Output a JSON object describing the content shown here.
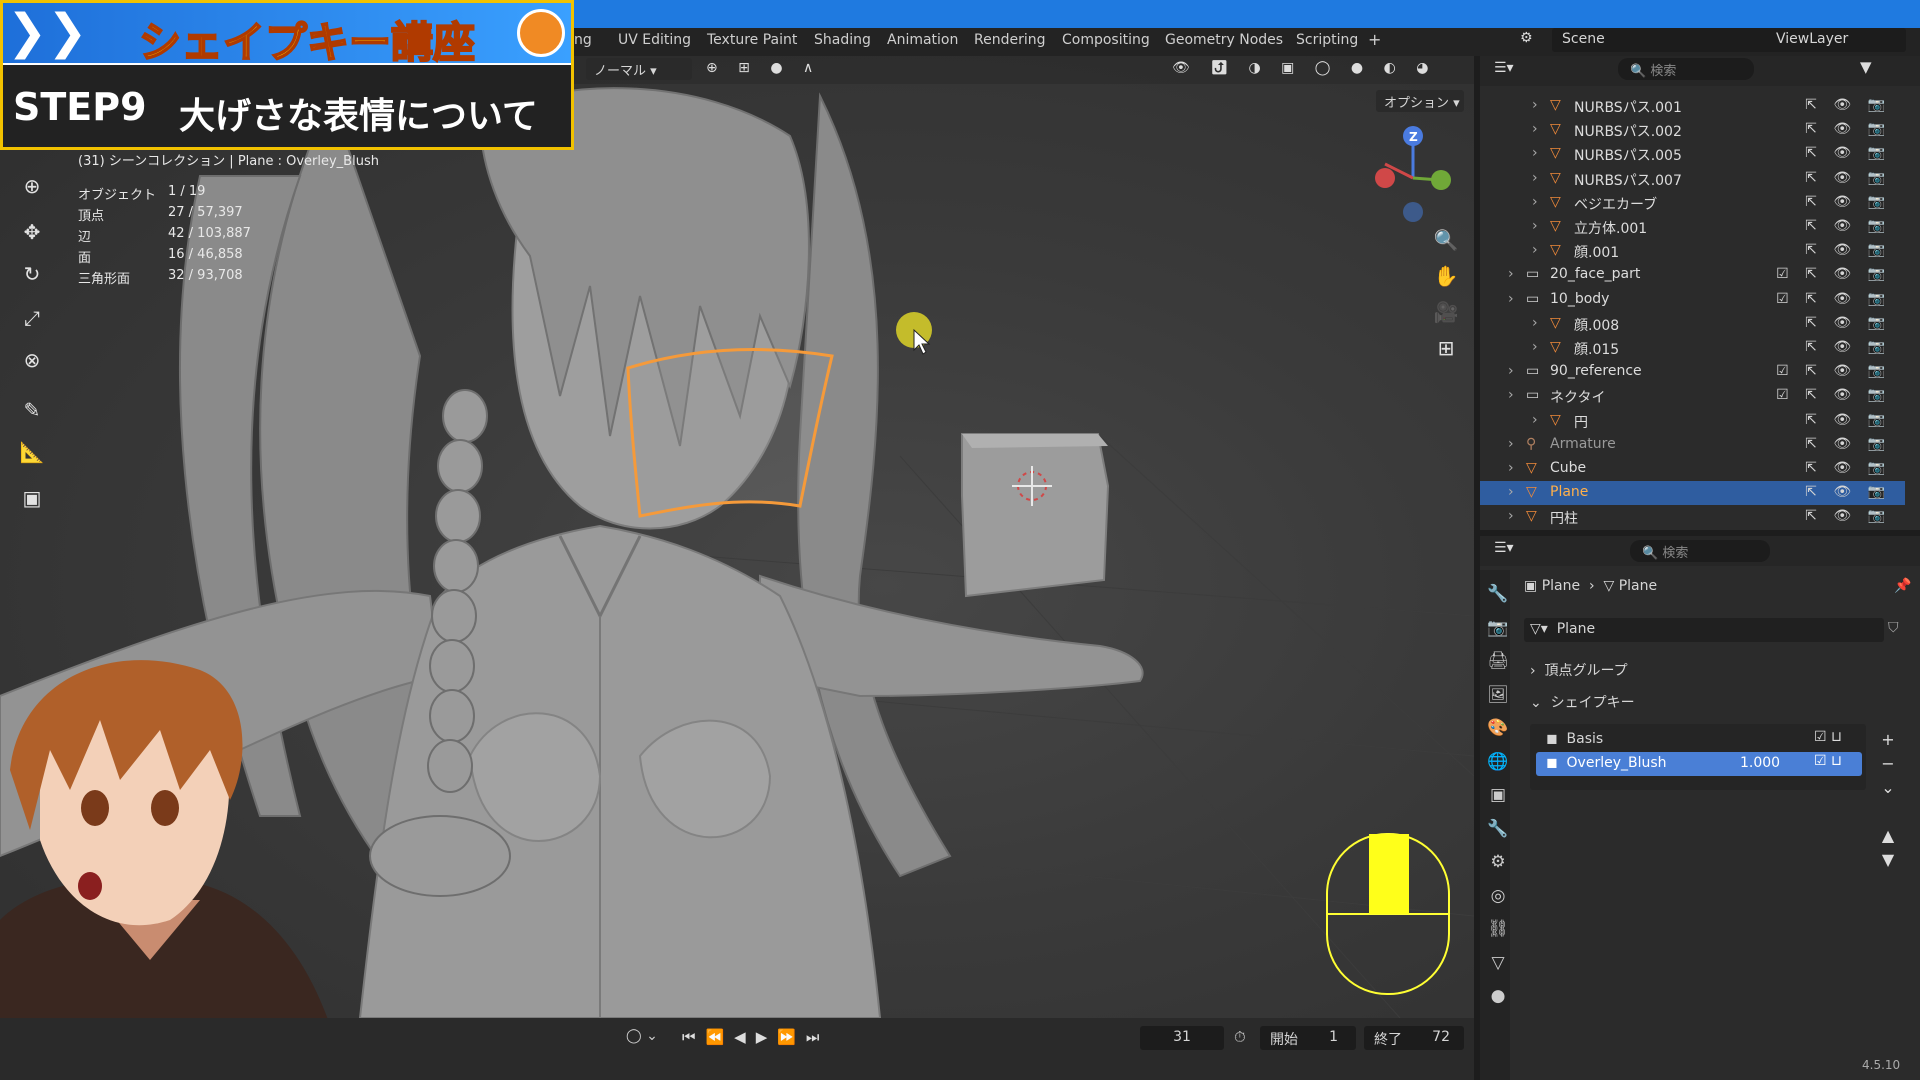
{
  "overlay": {
    "banner_title": "シェイプキー講座",
    "step_label": "STEP9",
    "step_title": "大げさな表情について"
  },
  "workspace_tabs": [
    "ng",
    "UV Editing",
    "Texture Paint",
    "Shading",
    "Animation",
    "Rendering",
    "Compositing",
    "Geometry Nodes",
    "Scripting",
    "+"
  ],
  "scene": {
    "label": "Scene",
    "view_layer": "ViewLayer"
  },
  "viewport": {
    "mode": "ノーマル",
    "options": "オプション",
    "collection_path": "(31) シーンコレクション | Plane : Overley_Blush",
    "stats": [
      {
        "label": "オブジェクト",
        "value": "1 / 19"
      },
      {
        "label": "頂点",
        "value": "27 / 57,397"
      },
      {
        "label": "辺",
        "value": "42 / 103,887"
      },
      {
        "label": "面",
        "value": "16 / 46,858"
      },
      {
        "label": "三角形面",
        "value": "32 / 93,708"
      }
    ],
    "gizmo_z": "Z"
  },
  "outliner": {
    "search_placeholder": "検索",
    "items": [
      {
        "name": "NURBSパス.001",
        "indent": 2,
        "type": "mesh"
      },
      {
        "name": "NURBSパス.002",
        "indent": 2,
        "type": "mesh"
      },
      {
        "name": "NURBSパス.005",
        "indent": 2,
        "type": "mesh"
      },
      {
        "name": "NURBSパス.007",
        "indent": 2,
        "type": "mesh"
      },
      {
        "name": "ベジエカーブ",
        "indent": 2,
        "type": "mesh"
      },
      {
        "name": "立方体.001",
        "indent": 2,
        "type": "mesh"
      },
      {
        "name": "顔.001",
        "indent": 2,
        "type": "mesh"
      },
      {
        "name": "20_face_part",
        "indent": 1,
        "type": "collection"
      },
      {
        "name": "10_body",
        "indent": 1,
        "type": "collection"
      },
      {
        "name": "顔.008",
        "indent": 2,
        "type": "mesh"
      },
      {
        "name": "顔.015",
        "indent": 2,
        "type": "mesh"
      },
      {
        "name": "90_reference",
        "indent": 1,
        "type": "collection"
      },
      {
        "name": "ネクタイ",
        "indent": 1,
        "type": "collection"
      },
      {
        "name": "円",
        "indent": 2,
        "type": "mesh"
      },
      {
        "name": "Armature",
        "indent": 1,
        "type": "armature"
      },
      {
        "name": "Cube",
        "indent": 1,
        "type": "mesh"
      },
      {
        "name": "Plane",
        "indent": 1,
        "type": "mesh",
        "selected": true
      },
      {
        "name": "円柱",
        "indent": 1,
        "type": "mesh"
      }
    ]
  },
  "properties": {
    "search_placeholder": "検索",
    "breadcrumb_object": "Plane",
    "breadcrumb_data": "Plane",
    "data_name": "Plane",
    "vertex_groups": "頂点グループ",
    "shape_keys": "シェイプキー",
    "keys": [
      {
        "name": "Basis",
        "value": ""
      },
      {
        "name": "Overley_Blush",
        "value": "1.000"
      }
    ]
  },
  "timeline": {
    "current_frame": "31",
    "start_label": "開始",
    "start_value": "1",
    "end_label": "終了",
    "end_value": "72"
  },
  "version": "4.5.10",
  "colors": {
    "accent": "#1f7ae0",
    "selection": "#f59a3a",
    "highlight_row": "#2f5da0",
    "key_active": "#4a7fd6"
  }
}
